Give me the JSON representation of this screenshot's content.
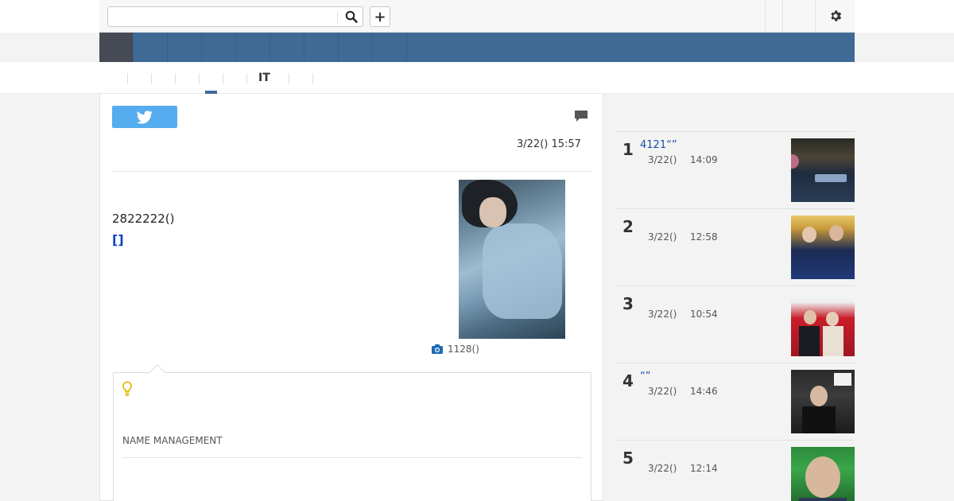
{
  "topbar": {
    "search_placeholder": "",
    "search_icon": "search-icon",
    "plus_label": "+",
    "settings_icon": "gear-icon"
  },
  "navbar": {
    "items": [
      "",
      "",
      "",
      "",
      "",
      "",
      "",
      "",
      ""
    ]
  },
  "subnav": {
    "it_label": "IT"
  },
  "article": {
    "timestamp": "3/22() 15:57",
    "text": "2822222()",
    "link": "[]",
    "photo_caption": "1128()"
  },
  "card": {
    "label": "NAME MANAGEMENT"
  },
  "ranking": [
    {
      "rank": "1",
      "title": "4121“”",
      "date": "3/22()",
      "time": "14:09"
    },
    {
      "rank": "2",
      "title": "",
      "date": "3/22()",
      "time": "12:58"
    },
    {
      "rank": "3",
      "title": "",
      "date": "3/22()",
      "time": "10:54"
    },
    {
      "rank": "4",
      "title": "“”",
      "date": "3/22()",
      "time": "14:46"
    },
    {
      "rank": "5",
      "title": "",
      "date": "3/22()",
      "time": "12:14"
    }
  ],
  "colors": {
    "nav_bg": "#3f6a96",
    "nav_active": "#454a55",
    "tweet": "#55acee",
    "link": "#0a3fbf"
  }
}
